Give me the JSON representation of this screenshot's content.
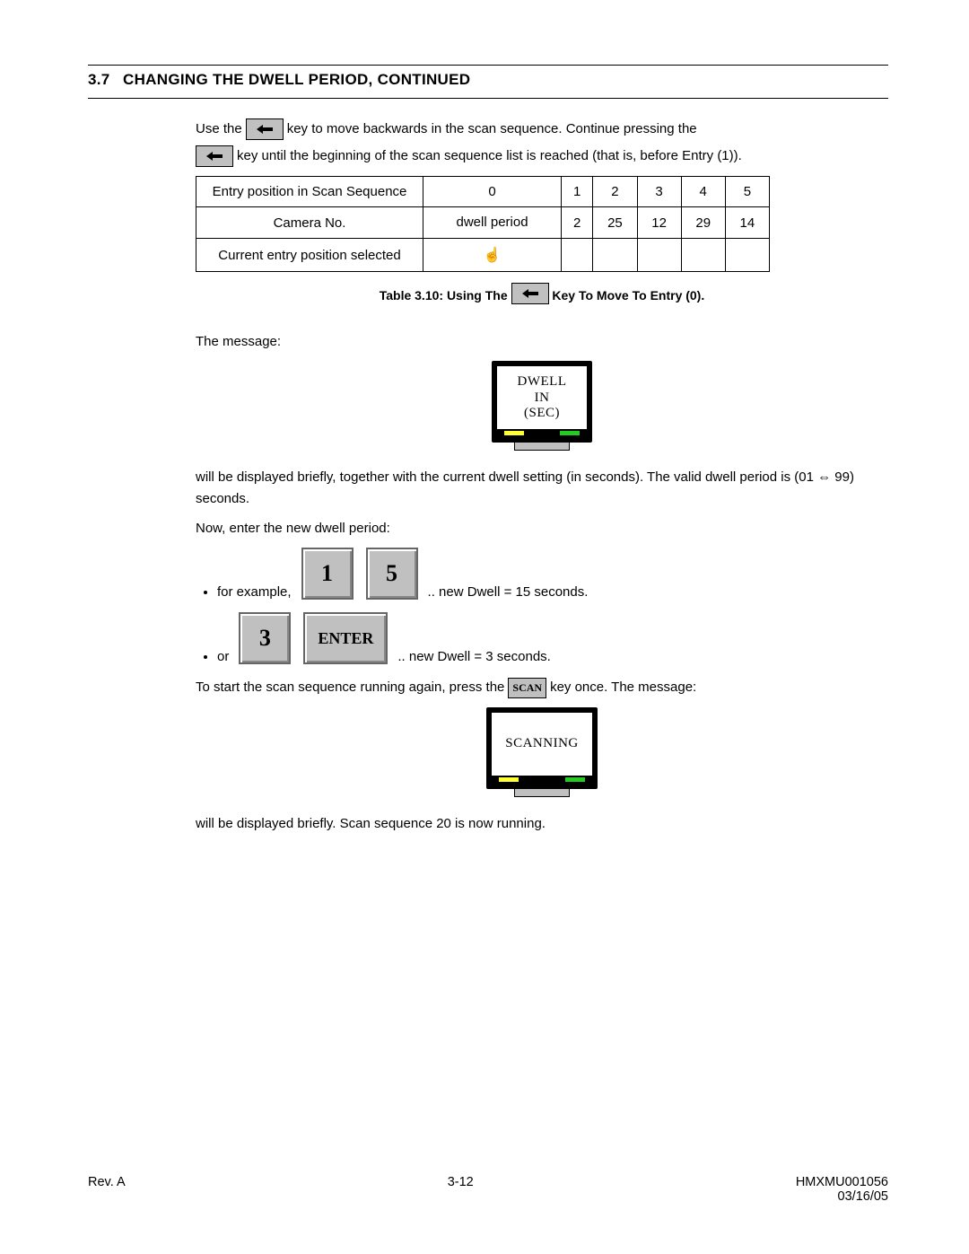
{
  "section": {
    "number": "3.7",
    "title": "CHANGING THE DWELL PERIOD, CONTINUED"
  },
  "p1a": "Use the",
  "p1b": "key to move backwards in the scan sequence.  Continue pressing the",
  "p1c": "key until the beginning of the scan sequence list is reached (that is, before Entry (1)).",
  "table": {
    "row0_label": "Entry position in Scan Sequence",
    "row0": [
      "0",
      "1",
      "2",
      "3",
      "4",
      "5"
    ],
    "row1_label": "Camera No.",
    "row1": [
      "dwell period",
      "2",
      "25",
      "12",
      "29",
      "14"
    ],
    "row2_label": "Current entry position selected",
    "row2_mark": "☝"
  },
  "caption_a": "Table 3.10:  Using The",
  "caption_b": "Key To Move To Entry (0).",
  "p2": "The message:",
  "monitor1": {
    "l1": "DWELL",
    "l2": "IN",
    "l3": "(SEC)"
  },
  "p3": "will be displayed briefly, together with the current dwell setting (in seconds). The valid dwell period is (01 ⇔ 99) seconds.",
  "p4": "Now, enter the new dwell period:",
  "ex1": {
    "lead": "for example,",
    "k1": "1",
    "k2": "5",
    "tail": ".. new Dwell = 15 seconds."
  },
  "ex2": {
    "lead": "or",
    "k1": "3",
    "k2": "ENTER",
    "tail": ".. new Dwell = 3 seconds."
  },
  "p5a": "To start the scan sequence running again, press the",
  "scan_label": "SCAN",
  "p5b": "key once.  The message:",
  "monitor2": {
    "l1": "SCANNING"
  },
  "p6": "will be displayed briefly.  Scan sequence 20 is now running.",
  "footer": {
    "left": "Rev. A",
    "center": "3-12",
    "right1": "HMXMU001056",
    "right2": "03/16/05"
  }
}
